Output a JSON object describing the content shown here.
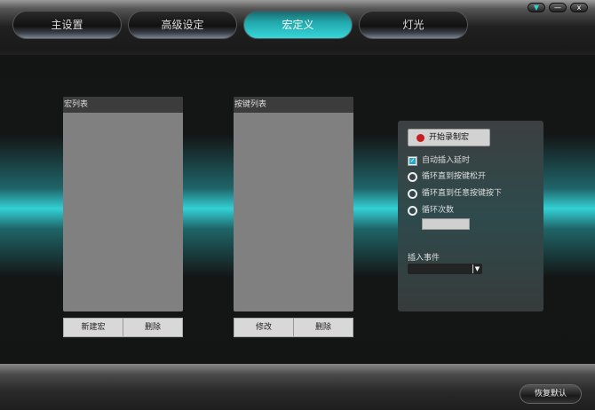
{
  "tabs": [
    {
      "label": "主设置"
    },
    {
      "label": "高级设定"
    },
    {
      "label": "宏定义",
      "active": true
    },
    {
      "label": "灯光"
    }
  ],
  "window_buttons": {
    "menu": "▼",
    "minimize": "—",
    "close": "x"
  },
  "macro_list": {
    "title": "宏列表",
    "new_label": "新建宏",
    "delete_label": "删除"
  },
  "key_list": {
    "title": "按键列表",
    "edit_label": "修改",
    "delete_label": "删除"
  },
  "record": {
    "start_label": "开始录制宏",
    "auto_delay_label": "自动插入延时",
    "auto_delay_checked": true,
    "options": [
      {
        "label": "循环直到按键松开"
      },
      {
        "label": "循环直到任意按键按下"
      },
      {
        "label": "循环次数"
      }
    ],
    "loop_count": "",
    "insert_event_label": "插入事件",
    "insert_event_value": ""
  },
  "restore_label": "恢复默认",
  "colors": {
    "accent": "#33d0d4",
    "record_dot": "#c81e1e"
  }
}
